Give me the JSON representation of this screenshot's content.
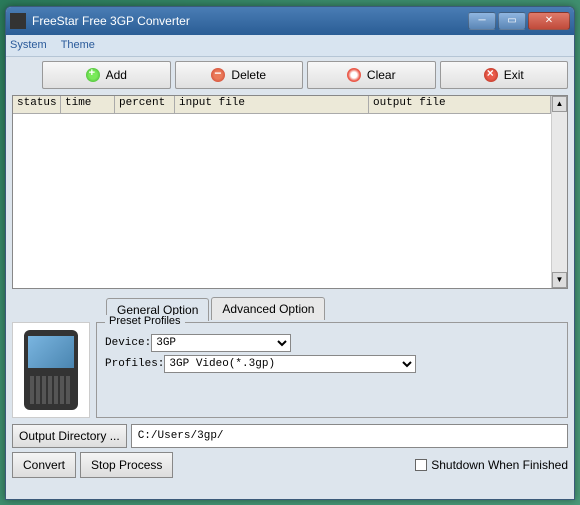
{
  "window": {
    "title": "FreeStar Free 3GP Converter"
  },
  "menubar": {
    "system": "System",
    "theme": "Theme"
  },
  "toolbar": {
    "add": "Add",
    "delete": "Delete",
    "clear": "Clear",
    "exit": "Exit"
  },
  "table": {
    "headers": {
      "status": "status",
      "time": "time",
      "percent": "percent",
      "input_file": "input file",
      "output_file": "output file"
    }
  },
  "tabs": {
    "general": "General Option",
    "advanced": "Advanced Option"
  },
  "preset": {
    "legend": "Preset Profiles",
    "device_label": "Device:",
    "device_value": "3GP",
    "profiles_label": "Profiles:",
    "profiles_value": "3GP Video(*.3gp)"
  },
  "output": {
    "button": "Output Directory ...",
    "path": "C:/Users/3gp/"
  },
  "actions": {
    "convert": "Convert",
    "stop": "Stop Process",
    "shutdown": "Shutdown When Finished"
  }
}
